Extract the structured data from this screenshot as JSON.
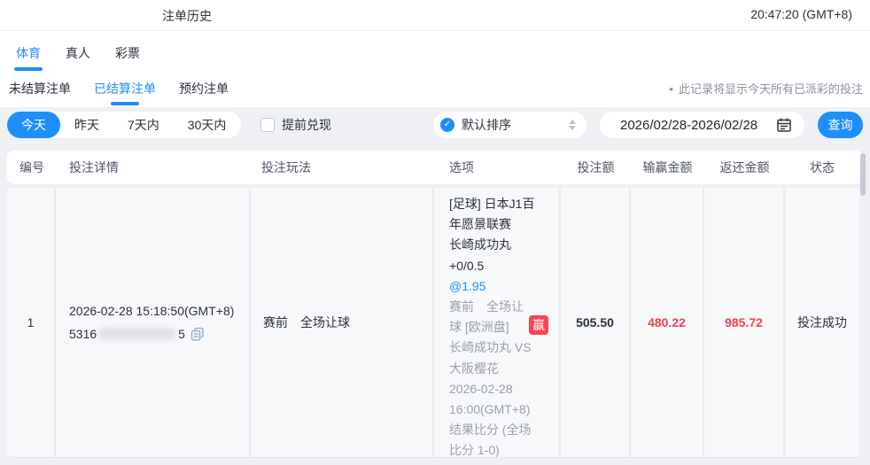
{
  "header": {
    "title": "注单历史",
    "time": "20:47:20 (GMT+8)"
  },
  "tabs": {
    "items": [
      {
        "label": "体育",
        "active": true
      },
      {
        "label": "真人",
        "active": false
      },
      {
        "label": "彩票",
        "active": false
      }
    ]
  },
  "subtabs": {
    "items": [
      {
        "label": "未结算注单",
        "active": false
      },
      {
        "label": "已结算注单",
        "active": true
      },
      {
        "label": "预约注单",
        "active": false
      }
    ],
    "note_bullet": "•",
    "note": "此记录将显示今天所有已派彩的投注"
  },
  "filters": {
    "ranges": [
      "今天",
      "昨天",
      "7天内",
      "30天内"
    ],
    "active_range": "今天",
    "cashout_label": "提前兑现",
    "sort_value": "默认排序",
    "date_range": "2026/02/28-2026/02/28",
    "query_label": "查询"
  },
  "icons": {
    "sort_check": "check-circle-icon",
    "sort_arrows": "sort-arrows-icon",
    "calendar": "calendar-icon",
    "copy": "copy-icon",
    "checkbox": "checkbox-unchecked"
  },
  "colors": {
    "accent_blue": "#1e8ffa",
    "loss_win_red": "#f2424d",
    "badge_red": "#f5454f",
    "page_bg": "#eef0f4",
    "row_bg": "#f7f8fa"
  },
  "table": {
    "columns": [
      "编号",
      "投注详情",
      "投注玩法",
      "选项",
      "投注额",
      "输赢金额",
      "返还金额",
      "状态"
    ],
    "rows": [
      {
        "no": "1",
        "detail_time": "2026-02-28 15:18:50(GMT+8)",
        "id_prefix": "5316",
        "id_suffix": "5",
        "play": "赛前　全场让球",
        "option_lines": [
          "[足球] 日本J1百",
          "年愿景联赛",
          "长崎成功丸",
          "+0/0.5",
          "@1.95",
          "赛前　全场让",
          "球 [欧洲盘]",
          "长崎成功丸 VS",
          "大阪樱花",
          "2026-02-28",
          "16:00(GMT+8)",
          "结果比分 (全场",
          "比分 1-0)"
        ],
        "result_badge": "赢",
        "bet_amount": "505.50",
        "win_loss": "480.22",
        "payout": "985.72",
        "status": "投注成功"
      }
    ]
  }
}
